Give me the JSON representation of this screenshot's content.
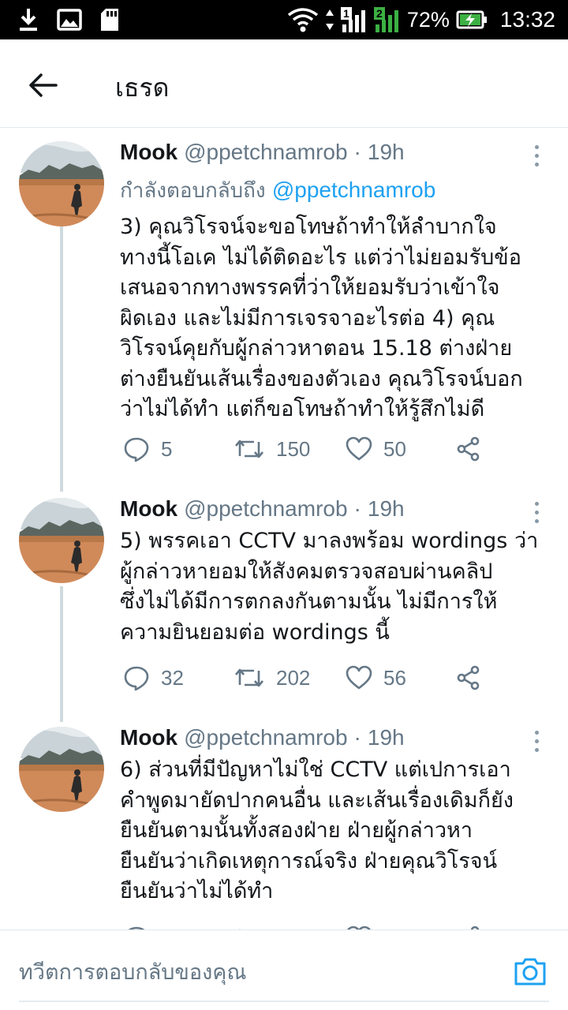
{
  "status_bar": {
    "battery": "72%",
    "sim1": "1",
    "sim2": "2",
    "time": "13:32"
  },
  "header": {
    "title": "เธรด"
  },
  "tweets": [
    {
      "name": "Mook",
      "handle": "@ppetchnamrob",
      "separator": "·",
      "time": "19h",
      "replying_prefix": "กำลังตอบกลับถึง",
      "replying_to": "@ppetchnamrob",
      "lines": [
        "3) คุณวิโรจน์จะขอโทษถ้าทำให้ลำบากใจ",
        "ทางนี้โอเค ไม่ได้ติดอะไร แต่ว่าไม่ยอมรับข้อ",
        "เสนอจากทางพรรคที่ว่าให้ยอมรับว่าเข้าใจ",
        "ผิดเอง และไม่มีการเจรจาอะไรต่อ 4) คุณ",
        "วิโรจน์คุยกับผู้กล่าวหาตอน 15.18 ต่างฝ่าย",
        "ต่างยืนยันเส้นเรื่องของตัวเอง คุณวิโรจน์บอก",
        "ว่าไม่ได้ทำ แต่ก็ขอโทษถ้าทำให้รู้สึกไม่ดี"
      ],
      "replies": "5",
      "retweets": "150",
      "likes": "50"
    },
    {
      "name": "Mook",
      "handle": "@ppetchnamrob",
      "separator": "·",
      "time": "19h",
      "lines": [
        "5) พรรคเอา CCTV มาลงพร้อม wordings ว่า",
        "ผู้กล่าวหายอมให้สังคมตรวจสอบผ่านคลิป",
        "ซึ่งไม่ได้มีการตกลงกันตามนั้น ไม่มีการให้",
        "ความยินยอมต่อ wordings นี้"
      ],
      "replies": "32",
      "retweets": "202",
      "likes": "56"
    },
    {
      "name": "Mook",
      "handle": "@ppetchnamrob",
      "separator": "·",
      "time": "19h",
      "lines": [
        "6) ส่วนที่มีปัญหาไม่ใช่ CCTV แต่เปการเอา",
        "คำพูดมายัดปากคนอื่น และเส้นเรื่องเดิมก็ยัง",
        "ยืนยันตามนั้นทั้งสองฝ่าย ฝ่ายผู้กล่าวหา",
        "ยืนยันว่าเกิดเหตุการณ์จริง ฝ่ายคุณวิโรจน์",
        "ยืนยันว่าไม่ได้ทำ"
      ]
    }
  ],
  "composer": {
    "placeholder": "ทวีตการตอบกลับของคุณ"
  },
  "colors": {
    "text": "#14171a",
    "secondary": "#657786",
    "link": "#1da1f2",
    "thread_line": "#cfd9de",
    "status_bar": "#000000"
  },
  "icons": {
    "back": "arrow-left-icon",
    "reply": "reply-bubble-icon",
    "retweet": "retweet-icon",
    "like": "heart-icon",
    "share": "share-icon",
    "more": "vertical-dots-icon",
    "camera": "camera-icon"
  }
}
